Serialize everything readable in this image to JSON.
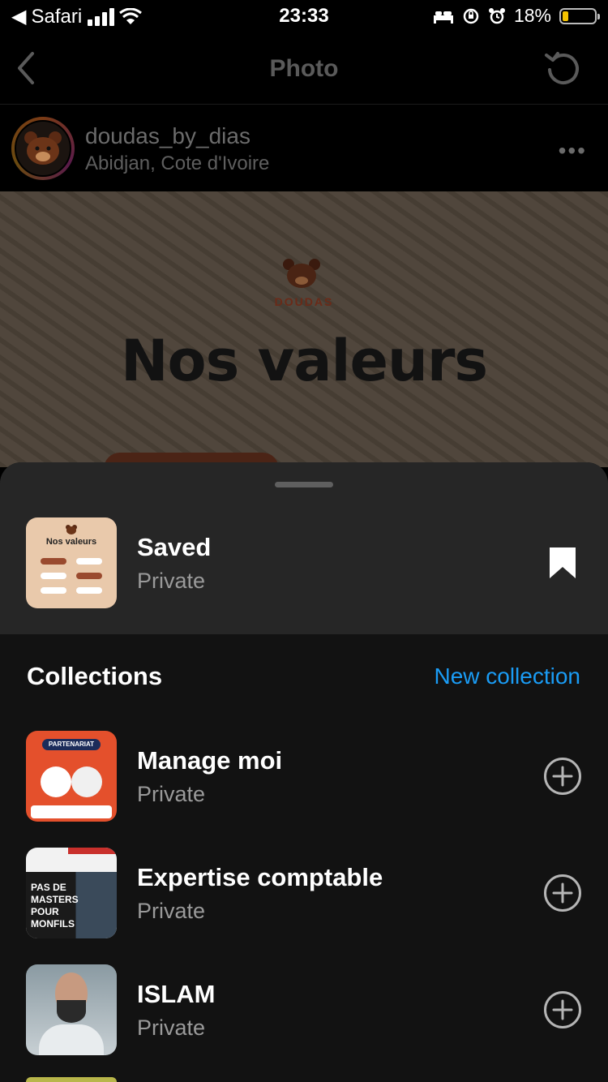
{
  "status_bar": {
    "back_app": "Safari",
    "time": "23:33",
    "battery": "18%",
    "battery_level": 0.18,
    "battery_color": "#f5c400"
  },
  "nav": {
    "title": "Photo",
    "back_icon": "chevron-left-icon",
    "refresh_icon": "refresh-icon"
  },
  "post": {
    "username": "doudas_by_dias",
    "location": "Abidjan, Cote d'Ivoire",
    "more_icon": "more-icon",
    "image": {
      "brand": "DOUDAS",
      "headline": "Nos valeurs"
    }
  },
  "sheet": {
    "saved": {
      "name": "Saved",
      "privacy": "Private",
      "thumb_title": "Nos valeurs"
    },
    "collections_title": "Collections",
    "new_collection_label": "New collection",
    "accent_color": "#1a9cf5",
    "collections": [
      {
        "name": "Manage moi",
        "privacy": "Private",
        "thumb_text": "PARTENARIAT"
      },
      {
        "name": "Expertise comptable",
        "privacy": "Private",
        "thumb_text": "PAS DE MASTERS POUR MONFILS"
      },
      {
        "name": "ISLAM",
        "privacy": "Private",
        "thumb_text": ""
      }
    ]
  }
}
